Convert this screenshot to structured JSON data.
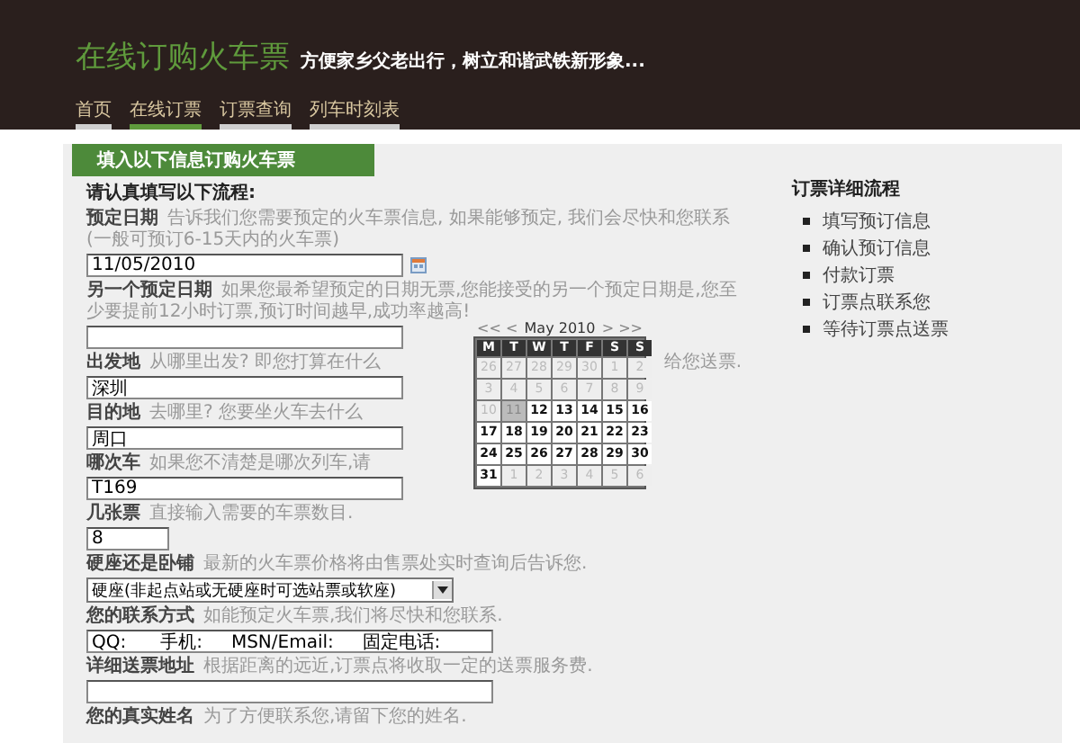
{
  "site": {
    "title": "在线订购火车票",
    "slogan": "方便家乡父老出行，树立和谐武铁新形象..."
  },
  "nav": [
    {
      "label": "首页",
      "selected": false
    },
    {
      "label": "在线订票",
      "selected": true
    },
    {
      "label": "订票查询",
      "selected": false
    },
    {
      "label": "列车时刻表",
      "selected": false
    }
  ],
  "form": {
    "tab": "填入以下信息订购火车票",
    "intro": "请认真填写以下流程:",
    "fields": [
      {
        "kind": "date",
        "label": "预定日期",
        "hint": "告诉我们您需要预定的火车票信息, 如果能够预定, 我们会尽快和您联系(一般可预订6-15天内的火车票)",
        "value": "11/05/2010"
      },
      {
        "kind": "text",
        "label": "另一个预定日期",
        "hint": "如果您最希望预定的日期无票,您能接受的另一个预定日期是,您至少要提前12小时订票,预订时间越早,成功率越高!"
      },
      {
        "kind": "text",
        "label": "出发地",
        "hint": "从哪里出发? 即您打算在什么",
        "tail": "给您送票.",
        "value": "深圳"
      },
      {
        "kind": "text",
        "label": "目的地",
        "hint": "去哪里? 您要坐火车去什么",
        "value": "周口"
      },
      {
        "kind": "text",
        "label": "哪次车",
        "hint": "如果您不清楚是哪次列车,请",
        "value": "T169"
      },
      {
        "kind": "short",
        "label": "几张票",
        "hint": "直接输入需要的车票数目.",
        "value": "8"
      },
      {
        "kind": "select",
        "label": "硬座还是卧铺",
        "hint": "最新的火车票价格将由售票处实时查询后告诉您.",
        "value": "硬座(非起点站或无硬座时可选站票或软座)"
      },
      {
        "kind": "text",
        "label": "您的联系方式",
        "hint": "如能预定火车票,我们将尽快和您联系.",
        "value": "QQ:      手机:     MSN/Email:     固定电话:"
      },
      {
        "kind": "text",
        "label": "详细送票地址",
        "hint": "根据距离的远近,订票点将收取一定的送票服务费."
      },
      {
        "kind": "label",
        "label": "您的真实姓名",
        "hint": "为了方便联系您,请留下您的姓名."
      }
    ]
  },
  "calendar": {
    "prev": "<< <",
    "month": "May 2010",
    "next": "> >>",
    "weekdays": [
      "M",
      "T",
      "W",
      "T",
      "F",
      "S",
      "S"
    ],
    "days": [
      {
        "day": "26",
        "kind": "other"
      },
      {
        "day": "27",
        "kind": "other"
      },
      {
        "day": "28",
        "kind": "other"
      },
      {
        "day": "29",
        "kind": "other"
      },
      {
        "day": "30",
        "kind": "other"
      },
      {
        "day": "1",
        "kind": "past"
      },
      {
        "day": "2",
        "kind": "past"
      },
      {
        "day": "3",
        "kind": "past"
      },
      {
        "day": "4",
        "kind": "past"
      },
      {
        "day": "5",
        "kind": "past"
      },
      {
        "day": "6",
        "kind": "past"
      },
      {
        "day": "7",
        "kind": "past"
      },
      {
        "day": "8",
        "kind": "past"
      },
      {
        "day": "9",
        "kind": "past"
      },
      {
        "day": "10",
        "kind": "past"
      },
      {
        "day": "11",
        "kind": "today"
      },
      {
        "day": "12",
        "kind": "open"
      },
      {
        "day": "13",
        "kind": "open"
      },
      {
        "day": "14",
        "kind": "open"
      },
      {
        "day": "15",
        "kind": "open"
      },
      {
        "day": "16",
        "kind": "open"
      },
      {
        "day": "17",
        "kind": "open"
      },
      {
        "day": "18",
        "kind": "open"
      },
      {
        "day": "19",
        "kind": "open"
      },
      {
        "day": "20",
        "kind": "open"
      },
      {
        "day": "21",
        "kind": "open"
      },
      {
        "day": "22",
        "kind": "open"
      },
      {
        "day": "23",
        "kind": "open"
      },
      {
        "day": "24",
        "kind": "open"
      },
      {
        "day": "25",
        "kind": "open"
      },
      {
        "day": "26",
        "kind": "open"
      },
      {
        "day": "27",
        "kind": "open"
      },
      {
        "day": "28",
        "kind": "open"
      },
      {
        "day": "29",
        "kind": "open"
      },
      {
        "day": "30",
        "kind": "open"
      },
      {
        "day": "31",
        "kind": "open"
      },
      {
        "day": "1",
        "kind": "other"
      },
      {
        "day": "2",
        "kind": "other"
      },
      {
        "day": "3",
        "kind": "other"
      },
      {
        "day": "4",
        "kind": "other"
      },
      {
        "day": "5",
        "kind": "other"
      },
      {
        "day": "6",
        "kind": "other"
      }
    ]
  },
  "sidebar": {
    "title": "订票详细流程",
    "items": [
      "填写预订信息",
      "确认预订信息",
      "付款订票",
      "订票点联系您",
      "等待订票点送票"
    ]
  }
}
